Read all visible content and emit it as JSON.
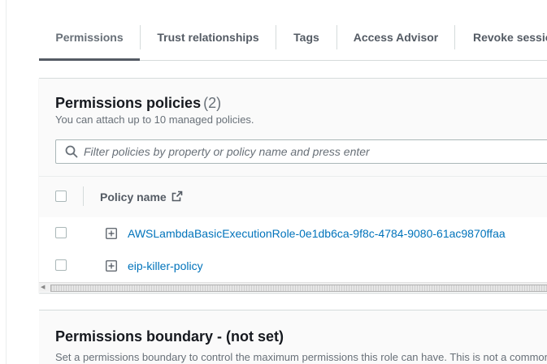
{
  "tabs": [
    {
      "label": "Permissions",
      "active": true
    },
    {
      "label": "Trust relationships",
      "active": false
    },
    {
      "label": "Tags",
      "active": false
    },
    {
      "label": "Access Advisor",
      "active": false
    },
    {
      "label": "Revoke sessions",
      "active": false
    }
  ],
  "permissions_policies": {
    "title": "Permissions policies",
    "count": "(2)",
    "description": "You can attach up to 10 managed policies.",
    "search_placeholder": "Filter policies by property or policy name and press enter",
    "search_value": "",
    "column_header": "Policy name",
    "rows": [
      {
        "name": "AWSLambdaBasicExecutionRole-0e1db6ca-9f8c-4784-9080-61ac9870ffaa"
      },
      {
        "name": "eip-killer-policy"
      }
    ]
  },
  "permissions_boundary": {
    "title": "Permissions boundary - (not set)",
    "description": "Set a permissions boundary to control the maximum permissions this role can have. This is not a common setting"
  },
  "colors": {
    "link": "#0073bb",
    "tab_active_underline": "#545b64",
    "heading": "#16191f",
    "muted": "#687078"
  },
  "icons": [
    "search-icon",
    "external-link-icon",
    "expand-plus-icon",
    "scroll-left-arrow-icon"
  ]
}
